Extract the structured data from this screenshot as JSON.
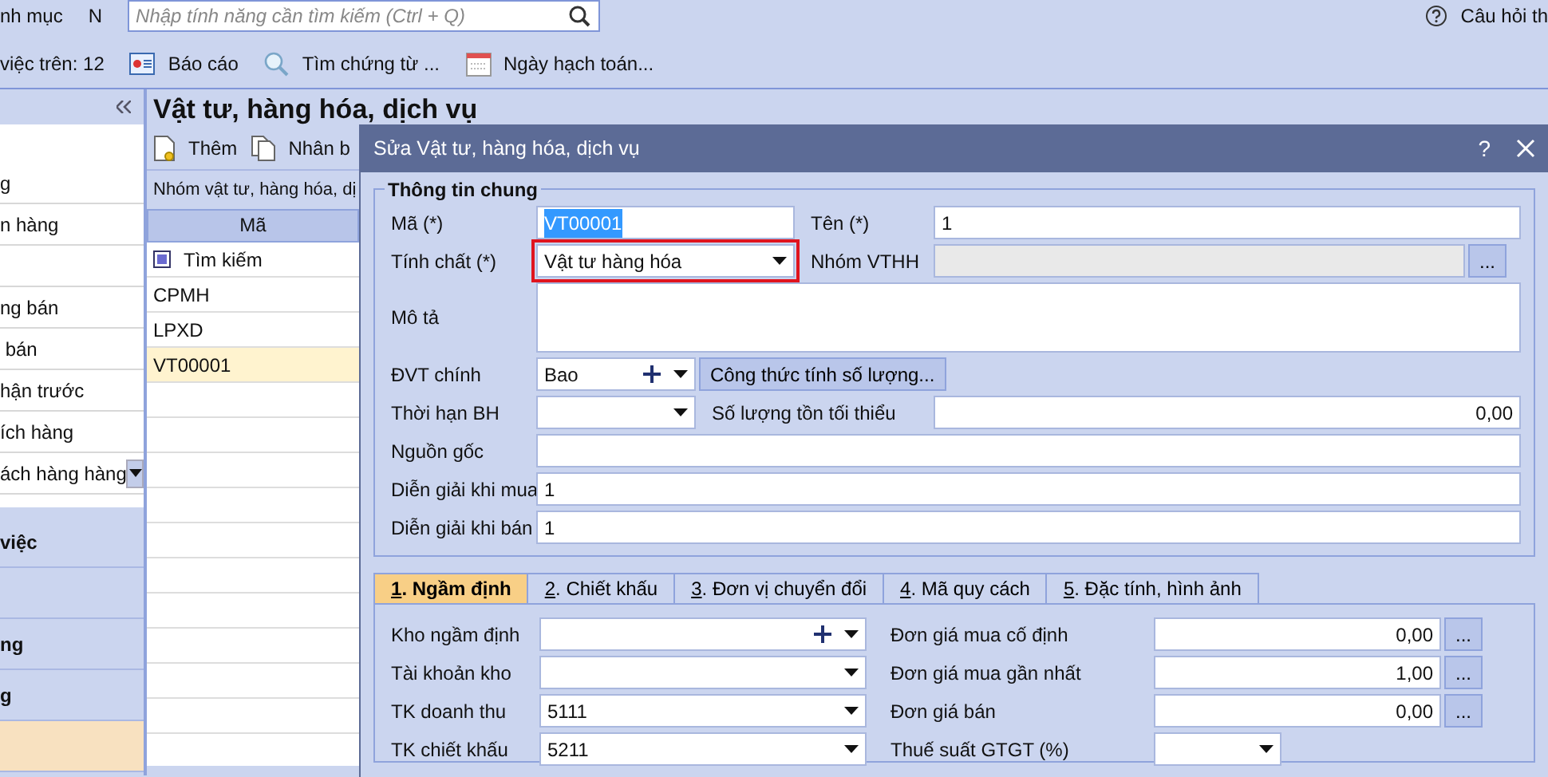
{
  "top_bar": {
    "category_label": "nh mục",
    "letter": "N",
    "search": {
      "placeholder": "Nhập tính năng cần tìm kiếm (Ctrl + Q)"
    },
    "help": "Câu hỏi th"
  },
  "toolbar": {
    "count_label": "việc trên: 12",
    "buttons": [
      {
        "kind": "report",
        "label": "Báo cáo"
      },
      {
        "kind": "search",
        "label": "Tìm chứng từ ..."
      },
      {
        "kind": "calendar",
        "label": "Ngày hạch toán..."
      }
    ]
  },
  "sidebar": {
    "items": [
      {
        "kind": "item",
        "label": "g"
      },
      {
        "kind": "item",
        "label": "n hàng"
      },
      {
        "kind": "blank"
      },
      {
        "kind": "item",
        "label": "ng bán"
      },
      {
        "kind": "item",
        "label": " bán"
      },
      {
        "kind": "item",
        "label": "hận trước"
      },
      {
        "kind": "item",
        "label": "ích hàng"
      },
      {
        "kind": "item",
        "label": "ách hàng hàng",
        "dropdown": true
      }
    ],
    "sections": [
      {
        "label": "việc",
        "selected": false
      },
      {
        "selected": false
      },
      {
        "label": "ng",
        "selected": false
      },
      {
        "label": "g",
        "selected": false
      },
      {
        "selected": true
      }
    ]
  },
  "list_panel": {
    "title": "Vật tư, hàng hóa, dịch vụ",
    "actions": [
      {
        "kind": "add",
        "label": "Thêm"
      },
      {
        "kind": "copy",
        "label": "Nhân b"
      }
    ],
    "group_bar": "Nhóm vật tư, hàng hóa, dị",
    "column": "Mã",
    "filter": {
      "label": "Tìm kiếm",
      "checked": true
    },
    "rows": [
      {
        "code": "CPMH",
        "selected": false
      },
      {
        "code": "LPXD",
        "selected": false
      },
      {
        "code": "VT00001",
        "selected": true
      }
    ]
  },
  "dialog": {
    "title": "Sửa Vật tư, hàng hóa, dịch vụ",
    "help": "?",
    "legend": "Thông tin chung",
    "rows": [
      [
        {
          "label": "Mã (*)",
          "kind": "text",
          "value": "VT00001",
          "selected": true
        },
        {
          "label": "Tên (*)",
          "kind": "text",
          "value": "1"
        }
      ],
      [
        {
          "label": "Tính chất (*)",
          "kind": "combo",
          "value": "Vật tư hàng hóa",
          "highlighted": true
        },
        {
          "label": "Nhóm VTHH",
          "kind": "readonly",
          "more": "..."
        }
      ],
      [
        {
          "label": "Mô tả",
          "kind": "area"
        }
      ],
      [
        {
          "label": "ĐVT chính",
          "kind": "unit_combo",
          "value": "Bao"
        },
        {
          "kind": "button",
          "value": "Công thức tính số lượng..."
        }
      ],
      [
        {
          "label": "Thời hạn BH",
          "kind": "short_combo"
        },
        {
          "label": "Số lượng tồn tối thiểu",
          "kind": "number",
          "value": "0,00"
        }
      ],
      [
        {
          "label": "Nguồn gốc",
          "kind": "text"
        }
      ],
      [
        {
          "label": "Diễn giải khi mua",
          "kind": "text",
          "value": "1"
        }
      ],
      [
        {
          "label": "Diễn giải khi bán",
          "kind": "text",
          "value": "1"
        }
      ]
    ],
    "tabs": [
      {
        "key": "1",
        "label": ". Ngầm định",
        "selected": true
      },
      {
        "key": "2",
        "label": ". Chiết khấu",
        "selected": false
      },
      {
        "key": "3",
        "label": ". Đơn vị chuyển đổi",
        "selected": false
      },
      {
        "key": "4",
        "label": ". Mã quy cách",
        "selected": false
      },
      {
        "key": "5",
        "label": ". Đặc tính, hình ảnh",
        "selected": false
      }
    ],
    "tab_rows": [
      [
        {
          "label": "Kho ngầm định",
          "kind": "unit_combo"
        },
        {
          "label": "Đơn giá mua cố định",
          "kind": "number",
          "value": "0,00",
          "more": "..."
        }
      ],
      [
        {
          "label": "Tài khoản kho",
          "kind": "combo"
        },
        {
          "label": "Đơn giá mua gần nhất",
          "kind": "number",
          "value": "1,00",
          "more": "..."
        }
      ],
      [
        {
          "label": "TK doanh thu",
          "kind": "combo",
          "value": "5111"
        },
        {
          "label": "Đơn giá bán",
          "kind": "number",
          "value": "0,00",
          "more": "..."
        }
      ],
      [
        {
          "label": "TK chiết khấu",
          "kind": "combo",
          "value": "5211"
        },
        {
          "label": "Thuế suất GTGT (%)",
          "kind": "short_combo"
        }
      ]
    ]
  }
}
